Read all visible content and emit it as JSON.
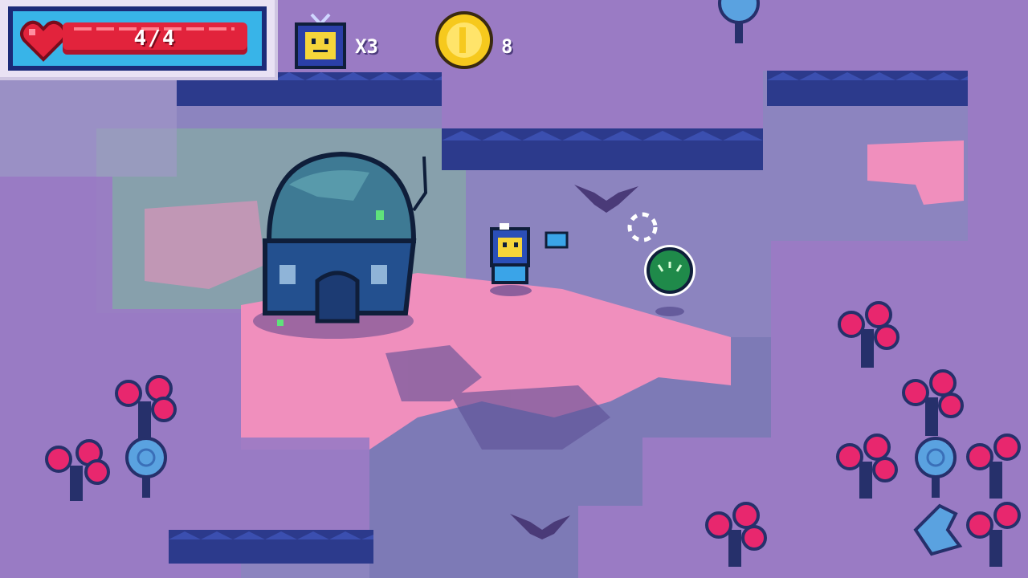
{
  "hud": {
    "health": {
      "current": 4,
      "max": 4,
      "text": "4/4",
      "fill": 1.0
    },
    "lives": {
      "icon": "robot-tv-icon",
      "text": "X3"
    },
    "coins": {
      "icon": "coin-icon",
      "text": "8"
    }
  },
  "colors": {
    "ground_purple": "#8f6fc0",
    "plateau": "#9a7bc4",
    "cliff": "#2c3a8c",
    "pink_path": "#f08fbd",
    "floor": "#7e78b8",
    "hp_red": "#e2233c",
    "hud_blue": "#38b4e8",
    "coin_gold": "#f6c91d"
  }
}
